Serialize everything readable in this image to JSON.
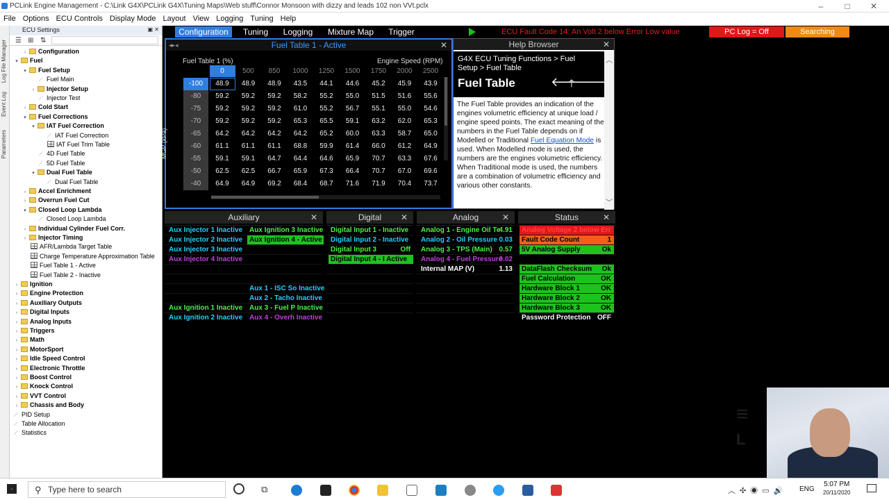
{
  "titlebar": {
    "title": "PCLink Engine Management - C:\\Link G4X\\PCLink G4X\\Tuning Maps\\Web stuff\\Connor Monsoon with dizzy and leads 102 non VVt.pclx"
  },
  "menu": [
    "File",
    "Options",
    "ECU Controls",
    "Display Mode",
    "Layout",
    "View",
    "Logging",
    "Tuning",
    "Help"
  ],
  "sidetabs": [
    "Log File Manager",
    "Event Log",
    "Parameters"
  ],
  "tree": {
    "header": "ECU Settings",
    "items": [
      {
        "label": "Configuration",
        "indent": 1,
        "type": "folder",
        "bold": true,
        "exp": "›"
      },
      {
        "label": "Fuel",
        "indent": 0,
        "type": "folder",
        "bold": true,
        "exp": "▾"
      },
      {
        "label": "Fuel Setup",
        "indent": 1,
        "type": "folder",
        "bold": true,
        "exp": "▾"
      },
      {
        "label": "Fuel Main",
        "indent": 3,
        "type": "leaf"
      },
      {
        "label": "Injector Setup",
        "indent": 2,
        "type": "folder",
        "bold": true,
        "exp": "›"
      },
      {
        "label": "Injector Test",
        "indent": 3,
        "type": "leaf"
      },
      {
        "label": "Cold Start",
        "indent": 1,
        "type": "folder",
        "bold": true,
        "exp": "›"
      },
      {
        "label": "Fuel Corrections",
        "indent": 1,
        "type": "folder",
        "bold": true,
        "exp": "▾"
      },
      {
        "label": "IAT Fuel Correction",
        "indent": 2,
        "type": "folder",
        "bold": true,
        "exp": "▾"
      },
      {
        "label": "IAT Fuel Correction",
        "indent": 4,
        "type": "leaf"
      },
      {
        "label": "IAT Fuel Trim Table",
        "indent": 4,
        "type": "table"
      },
      {
        "label": "4D Fuel Table",
        "indent": 3,
        "type": "leaf"
      },
      {
        "label": "5D Fuel Table",
        "indent": 3,
        "type": "leaf"
      },
      {
        "label": "Dual Fuel Table",
        "indent": 2,
        "type": "folder",
        "bold": true,
        "exp": "▾"
      },
      {
        "label": "Dual Fuel Table",
        "indent": 4,
        "type": "leaf"
      },
      {
        "label": "Accel Enrichment",
        "indent": 1,
        "type": "folder",
        "bold": true,
        "exp": "›"
      },
      {
        "label": "Overrun Fuel Cut",
        "indent": 1,
        "type": "folder",
        "bold": true,
        "exp": "›"
      },
      {
        "label": "Closed Loop Lambda",
        "indent": 1,
        "type": "folder",
        "bold": true,
        "exp": "▾"
      },
      {
        "label": "Closed Loop Lambda",
        "indent": 3,
        "type": "leaf"
      },
      {
        "label": "Individual Cylinder Fuel Corr.",
        "indent": 1,
        "type": "folder",
        "bold": true,
        "exp": "›"
      },
      {
        "label": "Injector Timing",
        "indent": 1,
        "type": "folder",
        "bold": true,
        "exp": "›"
      },
      {
        "label": "AFR/Lambda Target Table",
        "indent": 2,
        "type": "table"
      },
      {
        "label": "Charge Temperature Approximation Table",
        "indent": 2,
        "type": "table"
      },
      {
        "label": "Fuel Table 1 - Active",
        "indent": 2,
        "type": "table"
      },
      {
        "label": "Fuel Table 2 - Inactive",
        "indent": 2,
        "type": "table"
      },
      {
        "label": "Ignition",
        "indent": 0,
        "type": "folder",
        "bold": true,
        "exp": "›"
      },
      {
        "label": "Engine Protection",
        "indent": 0,
        "type": "folder",
        "bold": true,
        "exp": "›"
      },
      {
        "label": "Auxiliary Outputs",
        "indent": 0,
        "type": "folder",
        "bold": true,
        "exp": "›"
      },
      {
        "label": "Digital Inputs",
        "indent": 0,
        "type": "folder",
        "bold": true,
        "exp": "›"
      },
      {
        "label": "Analog Inputs",
        "indent": 0,
        "type": "folder",
        "bold": true,
        "exp": "›"
      },
      {
        "label": "Triggers",
        "indent": 0,
        "type": "folder",
        "bold": true,
        "exp": "›"
      },
      {
        "label": "Math",
        "indent": 0,
        "type": "folder",
        "bold": true,
        "exp": "›"
      },
      {
        "label": "MotorSport",
        "indent": 0,
        "type": "folder",
        "bold": true,
        "exp": "›"
      },
      {
        "label": "Idle Speed Control",
        "indent": 0,
        "type": "folder",
        "bold": true,
        "exp": "›"
      },
      {
        "label": "Electronic Throttle",
        "indent": 0,
        "type": "folder",
        "bold": true,
        "exp": "›"
      },
      {
        "label": "Boost Control",
        "indent": 0,
        "type": "folder",
        "bold": true,
        "exp": "›"
      },
      {
        "label": "Knock Control",
        "indent": 0,
        "type": "folder",
        "bold": true,
        "exp": "›"
      },
      {
        "label": "VVT Control",
        "indent": 0,
        "type": "folder",
        "bold": true,
        "exp": "›"
      },
      {
        "label": "Chassis and Body",
        "indent": 0,
        "type": "folder",
        "bold": true,
        "exp": "›"
      },
      {
        "label": "PID Setup",
        "indent": 0,
        "type": "leaf"
      },
      {
        "label": "Table Allocation",
        "indent": 0,
        "type": "leaf"
      },
      {
        "label": "Statistics",
        "indent": 0,
        "type": "leaf"
      }
    ]
  },
  "toptabs": [
    "Configuration",
    "Tuning",
    "Logging",
    "Mixture Map",
    "Trigger"
  ],
  "fault": "ECU Fault Code 14: An Volt 2 below Error Low value",
  "pclog": "PC Log = Off",
  "searching": "Searching",
  "fueltable": {
    "title": "Fuel Table 1 - Active",
    "zlabel": "Fuel Table 1 (%)",
    "xlabel": "Engine Speed (RPM)",
    "ylabel": "MGP (kPa)",
    "rpm": [
      "0",
      "500",
      "850",
      "1000",
      "1250",
      "1500",
      "1750",
      "2000",
      "2500"
    ],
    "mgp": [
      "-100",
      "-80",
      "-75",
      "-70",
      "-65",
      "-60",
      "-55",
      "-50",
      "-40"
    ],
    "cells": [
      [
        "48.9",
        "48.9",
        "48.9",
        "43.5",
        "44.1",
        "44.6",
        "45.2",
        "45.9",
        "43.9"
      ],
      [
        "59.2",
        "59.2",
        "59.2",
        "58.2",
        "55.2",
        "55.0",
        "51.5",
        "51.6",
        "55.6"
      ],
      [
        "59.2",
        "59.2",
        "59.2",
        "61.0",
        "55.2",
        "56.7",
        "55.1",
        "55.0",
        "54.6"
      ],
      [
        "59.2",
        "59.2",
        "59.2",
        "65.3",
        "65.5",
        "59.1",
        "63.2",
        "62.0",
        "65.3"
      ],
      [
        "64.2",
        "64.2",
        "64.2",
        "64.2",
        "65.2",
        "60.0",
        "63.3",
        "58.7",
        "65.0"
      ],
      [
        "61.1",
        "61.1",
        "61.1",
        "68.8",
        "59.9",
        "61.4",
        "66.0",
        "61.2",
        "64.9"
      ],
      [
        "59.1",
        "59.1",
        "64.7",
        "64.4",
        "64.6",
        "65.9",
        "70.7",
        "63.3",
        "67.6"
      ],
      [
        "62.5",
        "62.5",
        "66.7",
        "65.9",
        "67.3",
        "66.4",
        "70.7",
        "67.0",
        "69.6"
      ],
      [
        "64.9",
        "64.9",
        "69.2",
        "68.4",
        "68.7",
        "71.6",
        "71.9",
        "70.4",
        "73.7"
      ]
    ]
  },
  "help": {
    "title": "Help Browser",
    "path": "G4X ECU Tuning Functions > Fuel Setup > Fuel Table",
    "heading": "Fuel Table",
    "body1": "The Fuel Table provides an indication of the engines volumetric efficiency at unique load / engine speed points. The exact meaning of the numbers in the Fuel Table depends on if Modelled or Traditional ",
    "link": "Fuel Equation Mode",
    "body2": " is used. When Modelled mode is used, the numbers are the engines volumetric efficiency. When Traditional mode is used, the numbers are a combination of volumetric efficiency and various other constants."
  },
  "sections": {
    "aux": "Auxiliary",
    "digital": "Digital",
    "analog": "Analog",
    "status": "Status"
  },
  "aux_col1": [
    {
      "text": "Aux Injector 1 Inactive",
      "color": "#23d0ff"
    },
    {
      "text": "Aux Injector 2 Inactive",
      "color": "#23d0ff"
    },
    {
      "text": "Aux Injector 3 Inactive",
      "color": "#23d0ff"
    },
    {
      "text": "Aux Injector 4 Inactive",
      "color": "#c040e0"
    },
    {
      "text": "Aux Ignition 1 Inactive",
      "color": "#4cf24c"
    },
    {
      "text": "Aux Ignition 2 Inactive",
      "color": "#23d0ff"
    }
  ],
  "aux_col2": [
    {
      "text": "Aux Ignition 3 Inactive",
      "color": "#4cf24c"
    },
    {
      "text": "Aux Ignition 4 - Active",
      "color": "#000",
      "bg": "#1ec21e"
    },
    {
      "text": "Aux 1 - ISC So Inactive",
      "color": "#23d0ff"
    },
    {
      "text": "Aux 2 - Tacho Inactive",
      "color": "#23d0ff"
    },
    {
      "text": "Aux 3 - Fuel P Inactive",
      "color": "#4cf24c"
    },
    {
      "text": "Aux 4 - Overh Inactive",
      "color": "#c040e0"
    }
  ],
  "digital": [
    {
      "text": "Digital Input  1 - Inactive",
      "color": "#4cf24c"
    },
    {
      "text": "Digital Input  2 - Inactive",
      "color": "#23d0ff"
    },
    {
      "text": "Digital Input  3",
      "value": "Off",
      "color": "#4cf24c"
    },
    {
      "text": "Digital Input  4 - I Active",
      "color": "#000",
      "bg": "#1ec21e"
    }
  ],
  "analog": [
    {
      "text": "Analog 1 - Engine Oil Te",
      "value": "4.91",
      "color": "#4cf24c"
    },
    {
      "text": "Analog 2 - Oil Pressure",
      "value": "0.03",
      "color": "#23d0ff"
    },
    {
      "text": "Analog 3 - TPS (Main)",
      "value": "0.57",
      "color": "#4cf24c"
    },
    {
      "text": "Analog 4 - Fuel Pressure",
      "value": "0.02",
      "color": "#c040e0"
    },
    {
      "text": "Internal MAP (V)",
      "value": "1.13",
      "color": "#fff"
    }
  ],
  "status": [
    {
      "text": "Analog Voltage 2 below Err",
      "value": "",
      "color": "#ff4040",
      "bg": "#e01818"
    },
    {
      "text": "Fault Code Count",
      "value": "1",
      "color": "#000",
      "bg": "#f06018"
    },
    {
      "text": "5V Analog Supply",
      "value": "Ok",
      "color": "#000",
      "bg": "#1ec21e"
    },
    {
      "text": "DataFlash Checksum",
      "value": "Ok",
      "color": "#000",
      "bg": "#1ec21e"
    },
    {
      "text": "Fuel Calculation",
      "value": "OK",
      "color": "#000",
      "bg": "#1ec21e"
    },
    {
      "text": "Hardware Block 1",
      "value": "OK",
      "color": "#000",
      "bg": "#1ec21e"
    },
    {
      "text": "Hardware Block 2",
      "value": "OK",
      "color": "#000",
      "bg": "#1ec21e"
    },
    {
      "text": "Hardware Block 3",
      "value": "OK",
      "color": "#000",
      "bg": "#1ec21e"
    },
    {
      "text": "Password Protection",
      "value": "OFF",
      "color": "#fff",
      "bg": "#000"
    }
  ],
  "taskbar": {
    "search": "Type here to search",
    "lang": "ENG",
    "time": "5:07 PM",
    "date": "20/11/2020"
  }
}
